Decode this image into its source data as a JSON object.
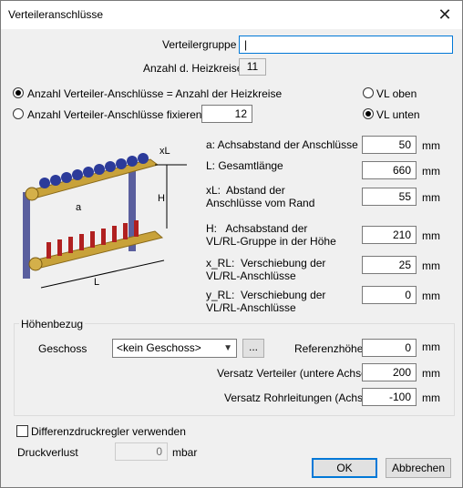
{
  "window": {
    "title": "Verteileranschlüsse"
  },
  "top": {
    "group_label": "Verteilergruppe",
    "group_value": "|",
    "heat_circuits_label": "Anzahl d. Heizkreise",
    "heat_circuits_value": "11"
  },
  "options": {
    "radio_equal": "Anzahl Verteiler-Anschlüsse = Anzahl der Heizkreise",
    "radio_fixed": "Anzahl Verteiler-Anschlüsse fixieren",
    "fixed_value": "12",
    "vl_oben": "VL oben",
    "vl_unten": "VL unten"
  },
  "params": [
    {
      "label": "a:   Achsabstand der Anschlüsse",
      "value": "50",
      "unit": "mm"
    },
    {
      "label": "L:   Gesamtlänge",
      "value": "660",
      "unit": "mm"
    },
    {
      "label": "xL:  Abstand der\nAnschlüsse vom Rand",
      "value": "55",
      "unit": "mm"
    },
    {
      "label": "H:   Achsabstand der\nVL/RL-Gruppe in der Höhe",
      "value": "210",
      "unit": "mm"
    },
    {
      "label": "x_RL:  Verschiebung der\nVL/RL-Anschlüsse",
      "value": "25",
      "unit": "mm"
    },
    {
      "label": "y_RL:  Verschiebung der\nVL/RL-Anschlüsse",
      "value": "0",
      "unit": "mm"
    }
  ],
  "diagram": {
    "xl": "xL",
    "h": "H",
    "a": "a",
    "l": "L"
  },
  "height_ref": {
    "title": "Höhenbezug",
    "floor_label": "Geschoss",
    "floor_value": "<kein Geschoss>",
    "more_button": "...",
    "ref_height_label": "Referenzhöhe",
    "ref_height_value": "0",
    "offset_dist_label": "Versatz Verteiler (untere Achse)",
    "offset_dist_value": "200",
    "offset_pipe_label": "Versatz Rohrleitungen (Achse)",
    "offset_pipe_value": "-100",
    "unit": "mm"
  },
  "bottom": {
    "diff_regulator": "Differenzdruckregler verwenden",
    "pressure_label": "Druckverlust",
    "pressure_value": "0",
    "pressure_unit": "mbar",
    "ok": "OK",
    "cancel": "Abbrechen"
  }
}
